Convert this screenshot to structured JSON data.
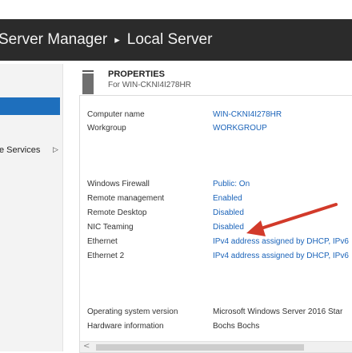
{
  "titlebar": {
    "app": "Server Manager",
    "separator": "▸",
    "page": "Local Server"
  },
  "nav": {
    "selected_item": "",
    "item": {
      "label": "e Services",
      "arrow": "▷"
    }
  },
  "properties": {
    "title": "PROPERTIES",
    "subtitle": "For WIN-CKNI4I278HR",
    "rows": [
      {
        "key": "Computer name",
        "value": "WIN-CKNI4I278HR",
        "link": true
      },
      {
        "key": "Workgroup",
        "value": "WORKGROUP",
        "link": true
      },
      {
        "key": "Windows Firewall",
        "value": "Public: On",
        "link": true
      },
      {
        "key": "Remote management",
        "value": "Enabled",
        "link": true
      },
      {
        "key": "Remote Desktop",
        "value": "Disabled",
        "link": true
      },
      {
        "key": "NIC Teaming",
        "value": "Disabled",
        "link": true
      },
      {
        "key": "Ethernet",
        "value": "IPv4 address assigned by DHCP, IPv6",
        "link": true
      },
      {
        "key": "Ethernet 2",
        "value": "IPv4 address assigned by DHCP, IPv6",
        "link": true
      },
      {
        "key": "Operating system version",
        "value": "Microsoft Windows Server 2016 Star",
        "link": false
      },
      {
        "key": "Hardware information",
        "value": "Bochs Bochs",
        "link": false
      }
    ]
  },
  "scrollbar": {
    "left_arrow": "<"
  },
  "colors": {
    "titlebar_bg": "#2b2b2b",
    "nav_selected": "#1e6fbd",
    "link": "#1a63b9",
    "callout_arrow": "#d23a2a"
  }
}
